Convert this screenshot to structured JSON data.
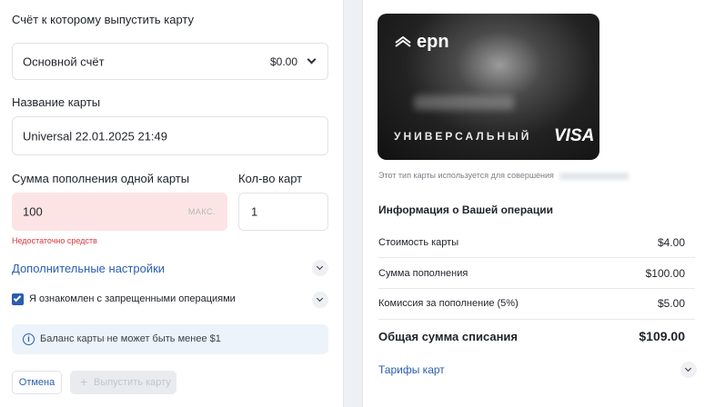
{
  "account": {
    "label": "Счёт к которому выпустить карту",
    "selected_name": "Основной счёт",
    "selected_balance": "$0.00"
  },
  "card_name": {
    "label": "Название карты",
    "value": "Universal 22.01.2025 21:49"
  },
  "topup": {
    "label": "Сумма пополнения одной карты",
    "value": "100",
    "max_label": "МАКС.",
    "error": "Недостаточно средств"
  },
  "count": {
    "label": "Кол-во карт",
    "value": "1"
  },
  "advanced_settings": "Дополнительные настройки",
  "agreement": {
    "checked": true,
    "label": "Я ознакомлен с запрещенными операциями"
  },
  "info_notice": "Баланс карты не может быть менее $1",
  "actions": {
    "cancel": "Отмена",
    "issue": "Выпустить карту"
  },
  "card": {
    "brand": "epn",
    "type": "УНИВЕРСАЛЬНЫЙ",
    "network": "VISA"
  },
  "card_description": "Этот тип карты используется для совершения",
  "operation": {
    "title": "Информация о Вашей операции",
    "rows": [
      {
        "label": "Стоимость карты",
        "value": "$4.00"
      },
      {
        "label": "Сумма пополнения",
        "value": "$100.00"
      },
      {
        "label": "Комиссия за пополнение (5%)",
        "value": "$5.00"
      }
    ],
    "total_label": "Общая сумма списания",
    "total_value": "$109.00"
  },
  "tariffs": "Тарифы карт",
  "colors": {
    "accent": "#2a5db0",
    "error": "#d9363e",
    "error_bg": "#fde4e4",
    "info_bg": "#edf3fb"
  }
}
